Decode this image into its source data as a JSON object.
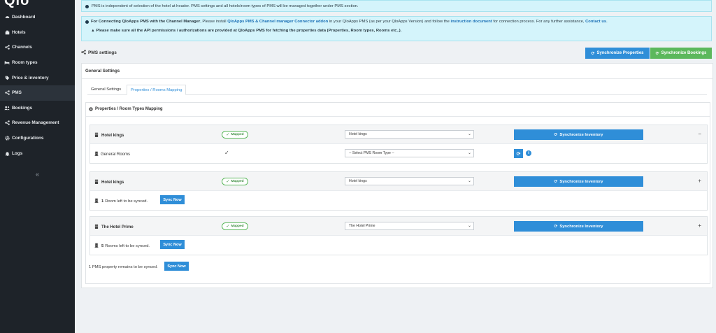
{
  "sidebar": {
    "logo": "Qlo",
    "items": [
      {
        "label": "Dashboard",
        "icon": "dashboard-icon"
      },
      {
        "label": "Hotels",
        "icon": "hotel-icon"
      },
      {
        "label": "Channels",
        "icon": "share-icon"
      },
      {
        "label": "Room types",
        "icon": "bed-icon"
      },
      {
        "label": "Price & inventory",
        "icon": "price-tag-icon"
      },
      {
        "label": "PMS",
        "icon": "share-icon"
      },
      {
        "label": "Bookings",
        "icon": "users-icon"
      },
      {
        "label": "Revenue Management",
        "icon": "share-icon"
      },
      {
        "label": "Configurations",
        "icon": "gear-icon"
      },
      {
        "label": "Logs",
        "icon": "bell-icon"
      }
    ],
    "collapse": "«"
  },
  "alerts": {
    "info": "PMS is independent of selection of the hotel at header. PMS settings and all hotels/room types of PMS will be managed together under PMS section.",
    "connect_bold": "For Connecting QloApps PMS with the Channel Manager",
    "connect_mid": ", Please install ",
    "connect_link1": "QloApps PMS & Channel manager Connector addon",
    "connect_mid2": " in your QloApps PMS (as per your QloApps Version) and follow the ",
    "connect_link2": "instruction document",
    "connect_mid3": " for connection process. For any further assistance, ",
    "connect_link3": "Contact us",
    "connect_end": ".",
    "warning": "Please make sure all the API permissions / authorizations are provided at QloApps PMS for fetching the properties data (Properties, Room types, Rooms etc..)."
  },
  "header": {
    "title": "PMS settings",
    "sync_properties": "Synchronize Properties",
    "sync_bookings": "Synchronize Bookings"
  },
  "panel": {
    "title": "General Settings",
    "tabs": [
      "General Settings",
      "Properties / Rooms Mapping"
    ],
    "mapping_title": "Properties / Room Types Mapping"
  },
  "cards": [
    {
      "hotel": "Hotel kings",
      "badge": "Mapped",
      "select": "Hotel kings",
      "sync": "Synchronize Inventory",
      "toggle": "−",
      "room": "General Rooms",
      "room_select": "-- Select PMS Room Type --"
    },
    {
      "hotel": "Hotel kings",
      "badge": "Mapped",
      "select": "Hotel kings",
      "sync": "Synchronize Inventory",
      "toggle": "+",
      "count": "1",
      "left_text": "Room left to be synced.",
      "sync_now": "Sync Now"
    },
    {
      "hotel": "The Hotel Prime",
      "badge": "Mapped",
      "select": "The Hotel Prime",
      "sync": "Synchronize Inventory",
      "toggle": "+",
      "count": "5",
      "left_text": "Rooms left to be synced.",
      "sync_now": "Sync Now"
    }
  ],
  "footer": {
    "text": "1 PMS property remains to be synced.",
    "sync_now": "Sync Now"
  },
  "colors": {
    "sidebar_bg": "#1e2329",
    "primary": "#2f8ed8",
    "success": "#5cb85c",
    "alert_bg": "#d4f4fb"
  }
}
